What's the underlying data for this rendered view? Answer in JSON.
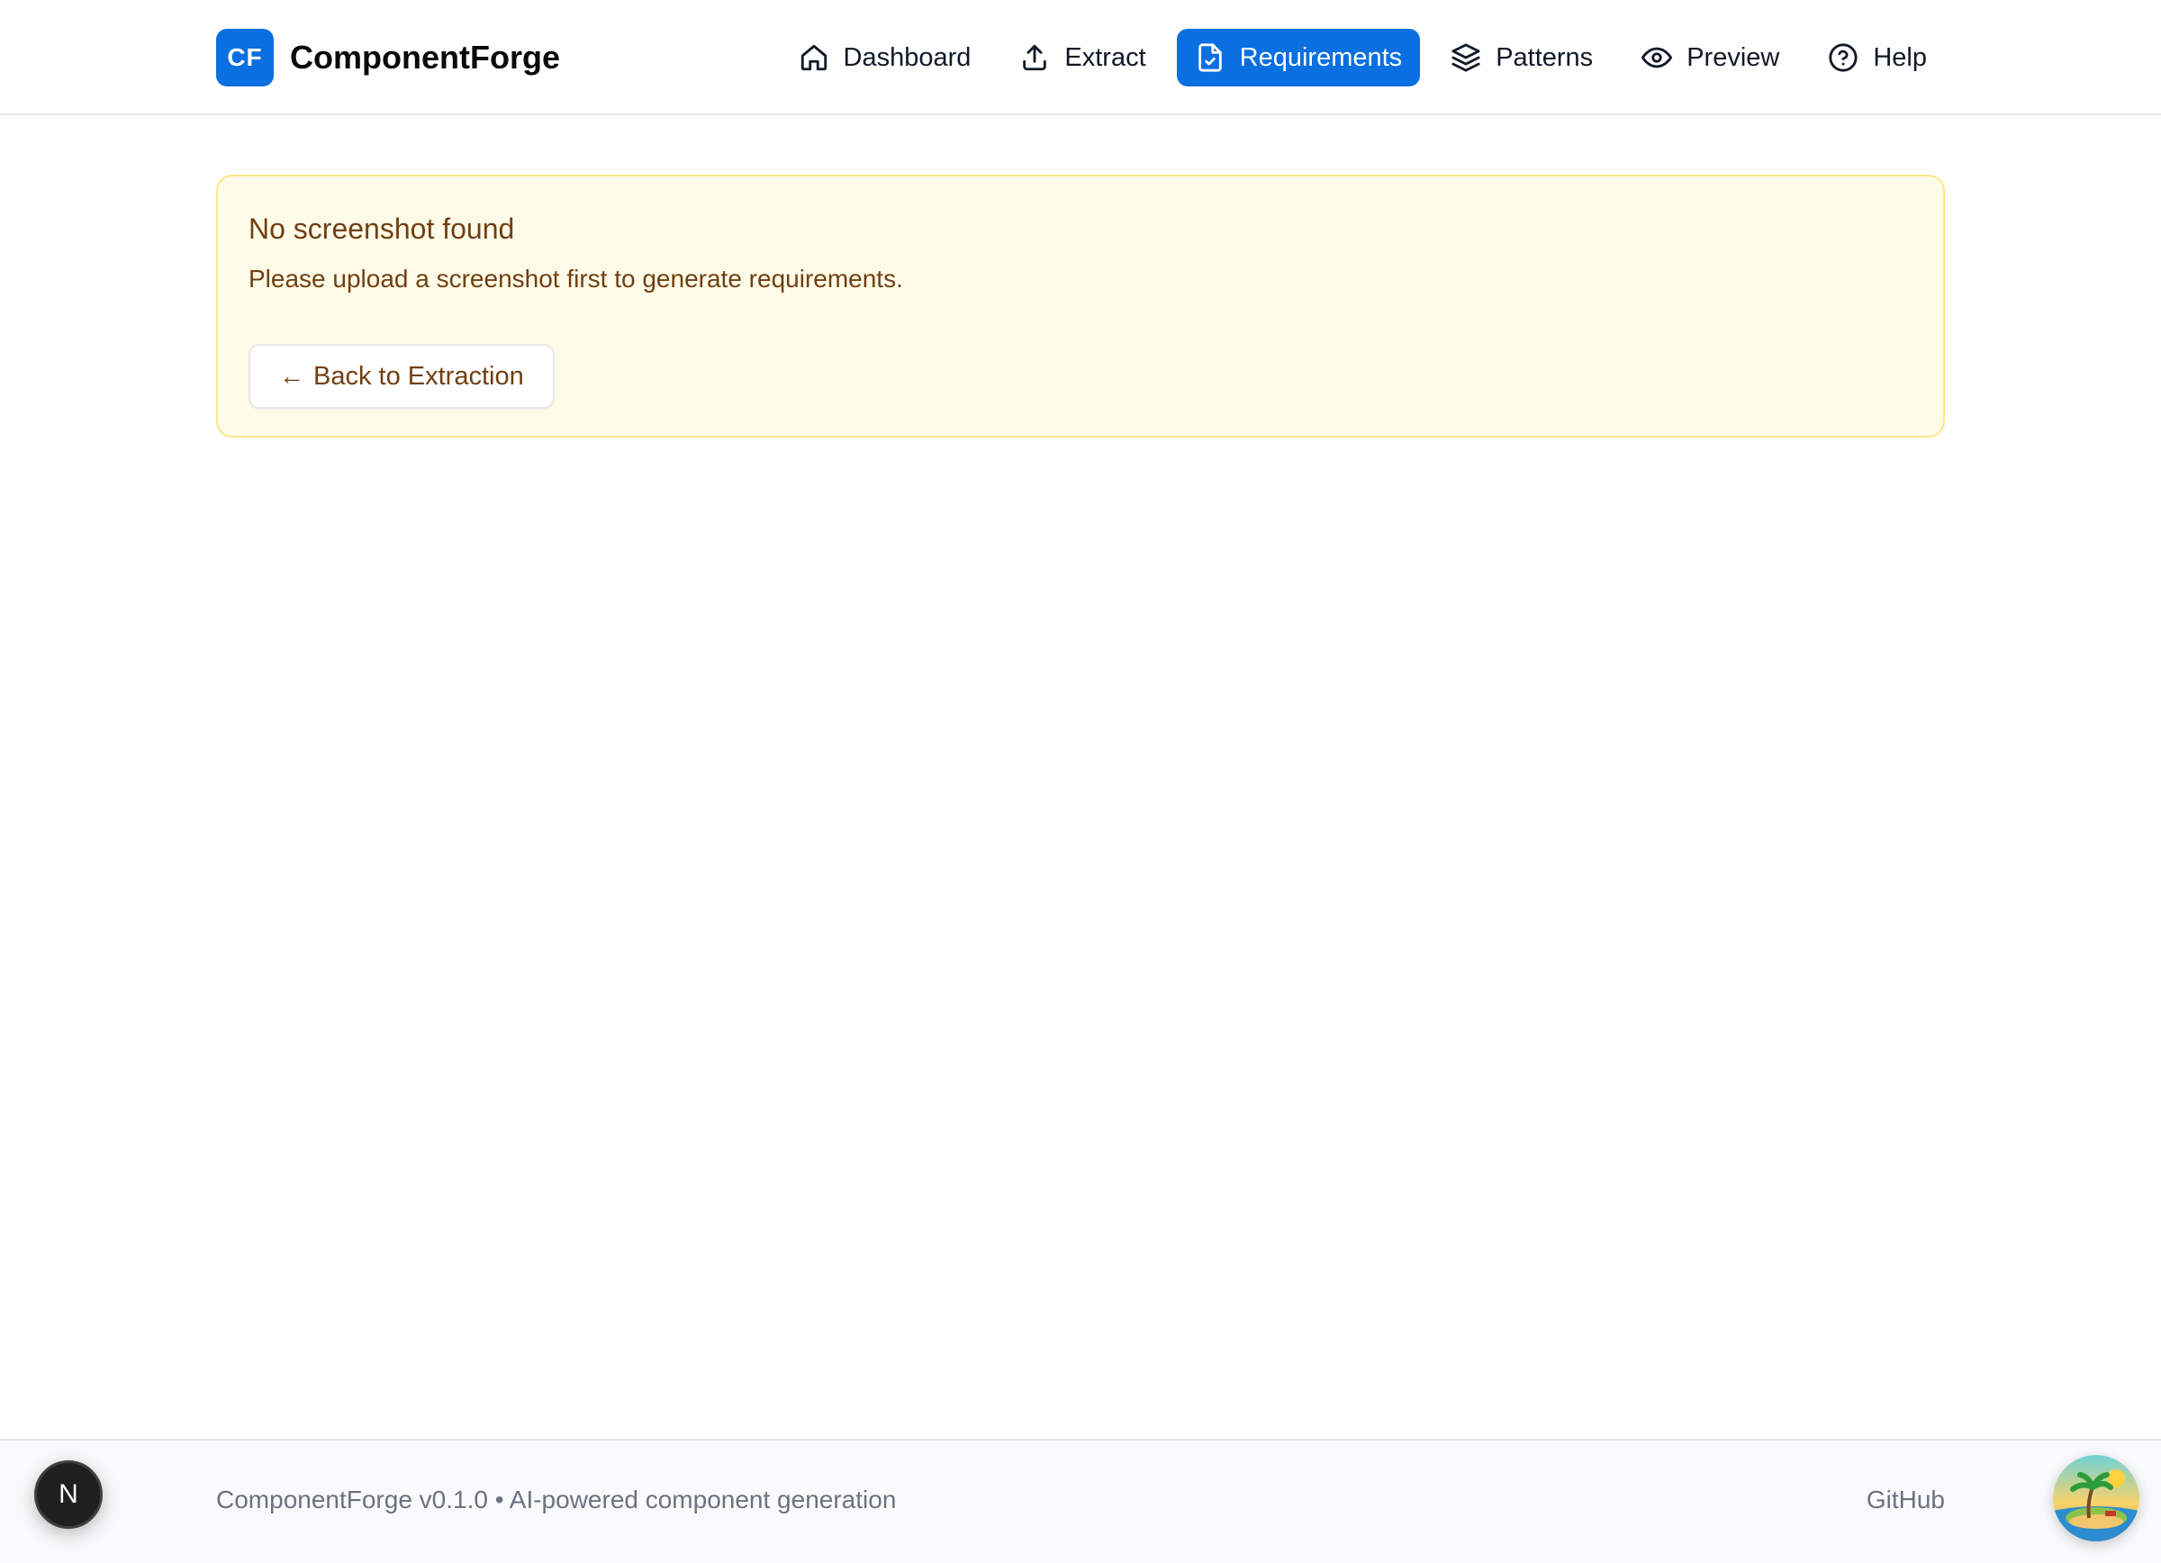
{
  "brand": {
    "badge": "CF",
    "name": "ComponentForge"
  },
  "nav": {
    "items": [
      {
        "label": "Dashboard",
        "icon": "home-icon",
        "active": false
      },
      {
        "label": "Extract",
        "icon": "upload-icon",
        "active": false
      },
      {
        "label": "Requirements",
        "icon": "file-check-icon",
        "active": true
      },
      {
        "label": "Patterns",
        "icon": "layers-icon",
        "active": false
      },
      {
        "label": "Preview",
        "icon": "eye-icon",
        "active": false
      },
      {
        "label": "Help",
        "icon": "help-circle-icon",
        "active": false
      }
    ]
  },
  "alert": {
    "title": "No screenshot found",
    "message": "Please upload a screenshot first to generate requirements.",
    "button_arrow": "←",
    "button_label": "Back to Extraction"
  },
  "footer": {
    "text": "ComponentForge v0.1.0 • AI-powered component generation",
    "link": "GitHub"
  },
  "widgets": {
    "next_badge": "N"
  },
  "colors": {
    "accent": "#0a6fe0",
    "alert_bg": "#fefce8",
    "alert_border": "#fde68a",
    "alert_text": "#713f12"
  }
}
